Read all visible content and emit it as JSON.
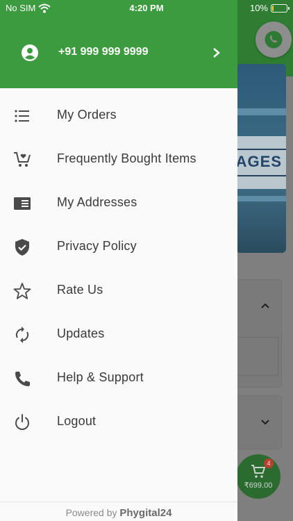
{
  "status_bar": {
    "carrier": "No SIM",
    "time": "4:20 PM",
    "battery": "10%",
    "battery_level": 0.1,
    "battery_color": "#f2d13b"
  },
  "drawer": {
    "header_color": "#3c9a3f",
    "phone": "+91 999 999 9999",
    "menu": [
      {
        "label": "My Orders",
        "icon": "list-icon"
      },
      {
        "label": "Frequently Bought Items",
        "icon": "cart-heart-icon"
      },
      {
        "label": "My Addresses",
        "icon": "address-card-icon"
      },
      {
        "label": "Privacy Policy",
        "icon": "shield-check-icon"
      },
      {
        "label": "Rate Us",
        "icon": "star-icon"
      },
      {
        "label": "Updates",
        "icon": "refresh-icon"
      },
      {
        "label": "Help & Support",
        "icon": "phone-icon"
      },
      {
        "label": "Logout",
        "icon": "power-icon"
      }
    ],
    "footer": {
      "prefix": "Powered by",
      "brand": "Phygital24"
    }
  },
  "background": {
    "banner_text": "AGES",
    "cart_total": "₹699.00",
    "cart_count": "4"
  }
}
